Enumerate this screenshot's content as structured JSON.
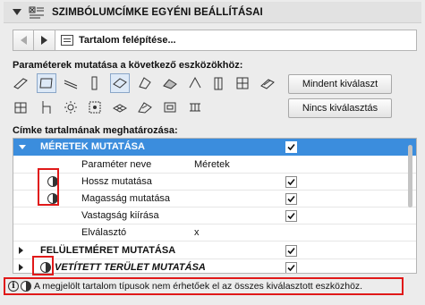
{
  "header": {
    "title": "SZIMBÓLUMCÍMKE EGYÉNI BEÁLLÍTÁSAI",
    "icon": "label-settings-icon"
  },
  "nav": {
    "selected": "Tartalom felépítése..."
  },
  "tools_label": "Paraméterek mutatása a következő eszközökhöz:",
  "tools_row1": [
    "wall-tool-icon",
    "slab-tool-icon",
    "beam-tool-icon",
    "column-tool-icon",
    "roof-tool-icon",
    "morph-tool-icon",
    "shell-tool-icon",
    "window-tool-icon",
    "door-tool-icon",
    "stair-tool-icon"
  ],
  "tools_row2": [
    "railing-tool-icon",
    "object-tool-icon",
    "lamp-tool-icon",
    "zone-tool-icon",
    "mesh-tool-icon",
    "curtainwall-tool-icon",
    "skylight-tool-icon",
    "opening-tool-icon"
  ],
  "buttons": {
    "select_all": "Mindent kiválaszt",
    "select_none": "Nincs kiválasztás"
  },
  "content_label": "Címke tartalmának meghatározása:",
  "tree": {
    "group1": {
      "label": "MÉRETEK MUTATÁSA",
      "checked": true
    },
    "items": [
      {
        "label": "Paraméter neve",
        "value": "Méretek",
        "check": false
      },
      {
        "label": "Hossz mutatása",
        "value": "",
        "check": true,
        "partial": true
      },
      {
        "label": "Magasság mutatása",
        "value": "",
        "check": true,
        "partial": true
      },
      {
        "label": "Vastagság kiírása",
        "value": "",
        "check": true,
        "partial": false
      },
      {
        "label": "Elválasztó",
        "value": "x",
        "check": false
      }
    ],
    "group2": {
      "label": "FELÜLETMÉRET MUTATÁSA",
      "checked": true
    },
    "group3": {
      "label": "VETÍTETT TERÜLET MUTATÁSA",
      "checked": true
    }
  },
  "warning": {
    "text": "A megjelölt tartalom típusok nem érhetőek el az összes kiválasztott eszközhöz."
  },
  "colors": {
    "selection": "#3b8ddd",
    "highlight": "#e01919"
  }
}
